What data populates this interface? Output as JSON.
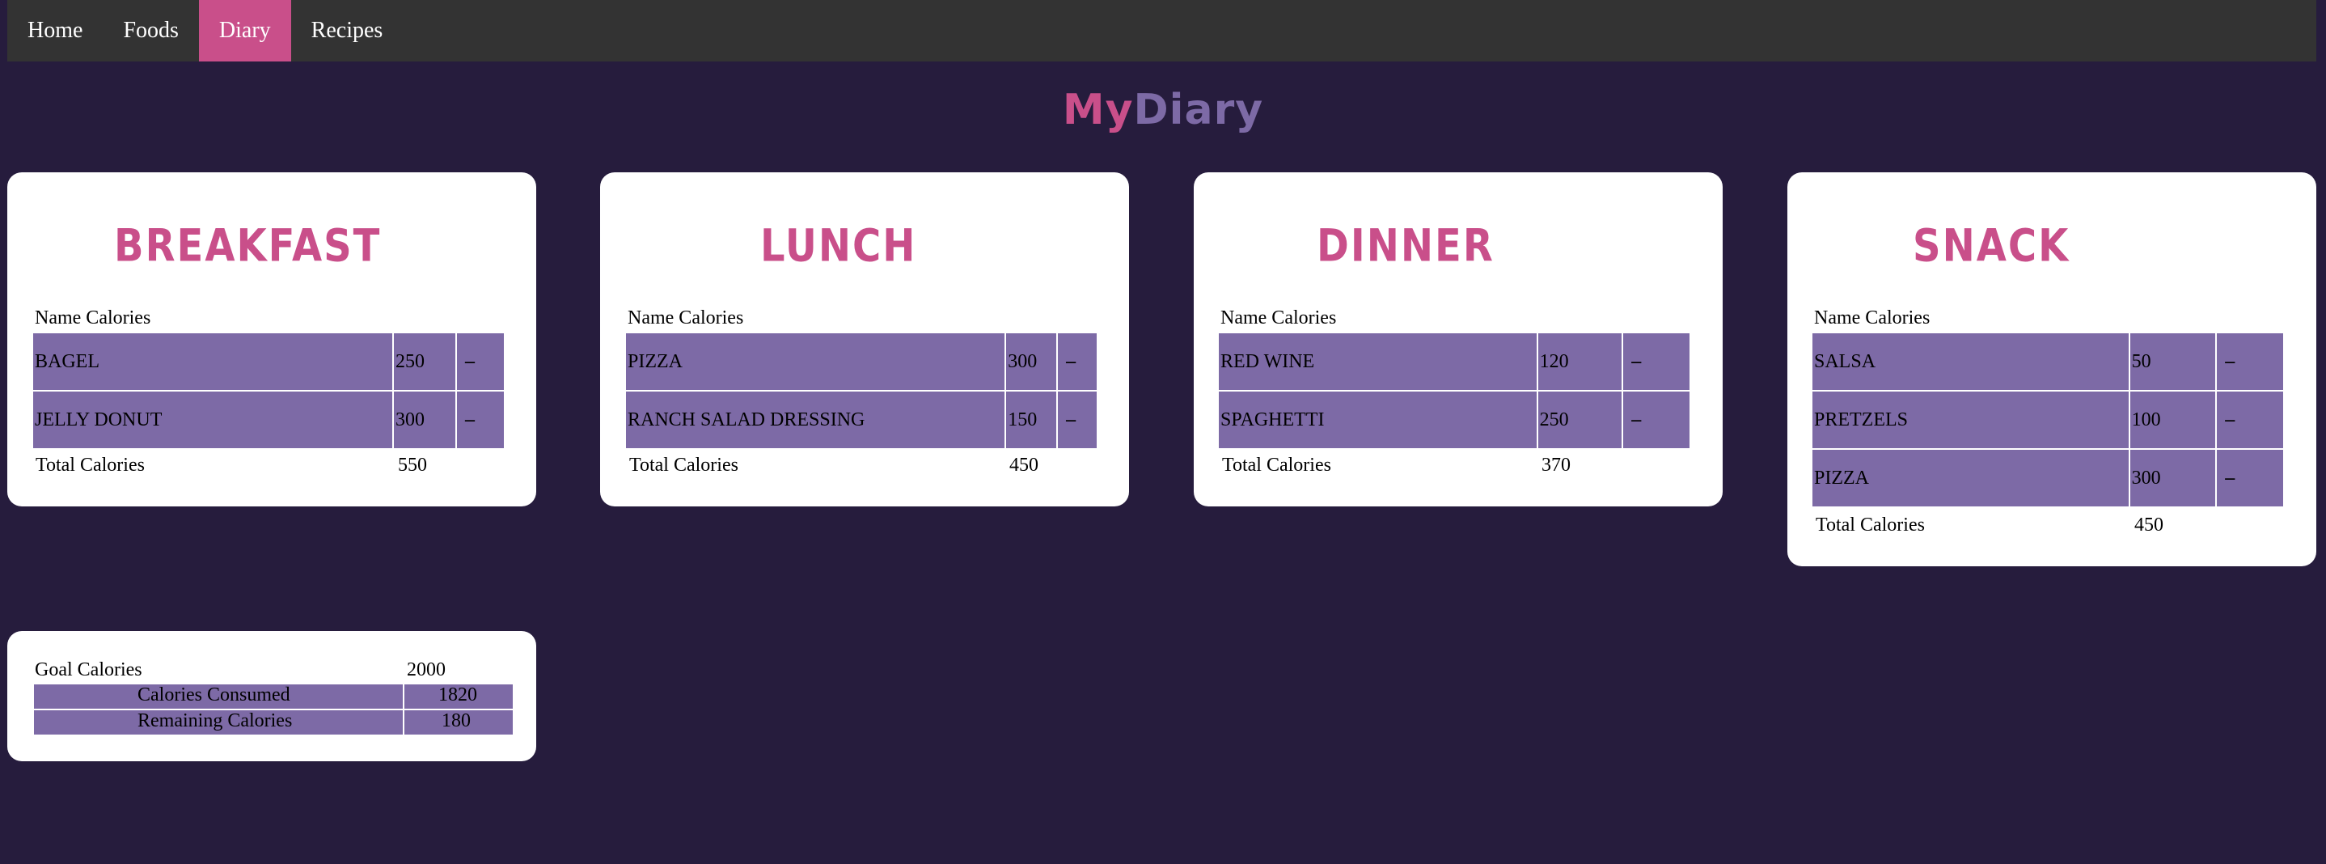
{
  "nav": {
    "items": [
      "Home",
      "Foods",
      "Diary",
      "Recipes"
    ],
    "active": "Diary"
  },
  "title": {
    "part1": "My",
    "part2": "Diary"
  },
  "colors": {
    "background": "#261c3d",
    "navbar": "#333333",
    "accent_pink": "#c94f8a",
    "accent_purple": "#7d6aa6",
    "card": "#ffffff"
  },
  "table_header": "Name Calories",
  "total_label": "Total Calories",
  "delete_symbol": "–",
  "meals": {
    "breakfast": {
      "title": "BREAKFAST",
      "items": [
        {
          "name": "BAGEL",
          "calories": "250"
        },
        {
          "name": "JELLY DONUT",
          "calories": "300"
        }
      ],
      "total": "550"
    },
    "lunch": {
      "title": "LUNCH",
      "items": [
        {
          "name": "PIZZA",
          "calories": "300"
        },
        {
          "name": "RANCH SALAD DRESSING",
          "calories": "150"
        }
      ],
      "total": "450"
    },
    "dinner": {
      "title": "DINNER",
      "items": [
        {
          "name": "RED WINE",
          "calories": "120"
        },
        {
          "name": "SPAGHETTI",
          "calories": "250"
        }
      ],
      "total": "370"
    },
    "snack": {
      "title": "SNACK",
      "items": [
        {
          "name": "SALSA",
          "calories": "50"
        },
        {
          "name": "PRETZELS",
          "calories": "100"
        },
        {
          "name": "PIZZA",
          "calories": "300"
        }
      ],
      "total": "450"
    }
  },
  "summary": {
    "goal_label": "Goal Calories",
    "goal_value": "2000",
    "consumed_label": "Calories Consumed",
    "consumed_value": "1820",
    "remaining_label": "Remaining Calories",
    "remaining_value": "180"
  }
}
